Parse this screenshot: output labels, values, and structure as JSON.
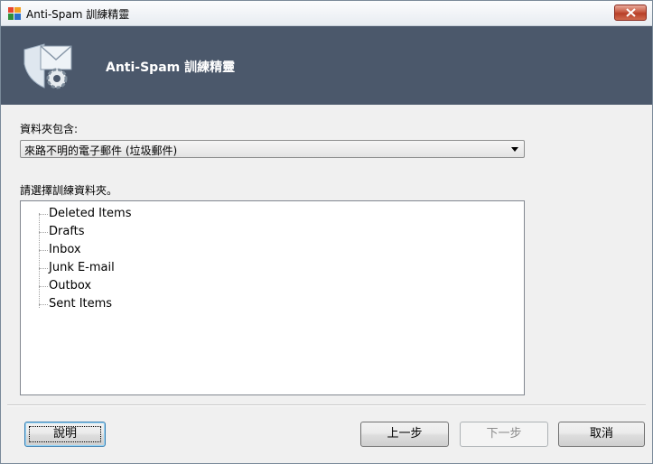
{
  "window": {
    "title": "Anti-Spam 訓練精靈",
    "icon": "avg-logo-icon",
    "close_icon": "close-x-icon"
  },
  "banner": {
    "title": "Anti-Spam 訓練精靈",
    "logo_icon": "shield-envelope-gear-icon"
  },
  "content": {
    "folder_contains_label": "資料夾包含:",
    "folder_contains_value": "來路不明的電子郵件 (垃圾郵件)",
    "select_folder_label": "請選擇訓練資料夾。",
    "folders": [
      "Deleted Items",
      "Drafts",
      "Inbox",
      "Junk E-mail",
      "Outbox",
      "Sent Items"
    ]
  },
  "footer": {
    "help_label": "說明",
    "back_label": "上一步",
    "next_label": "下一步",
    "cancel_label": "取消"
  }
}
